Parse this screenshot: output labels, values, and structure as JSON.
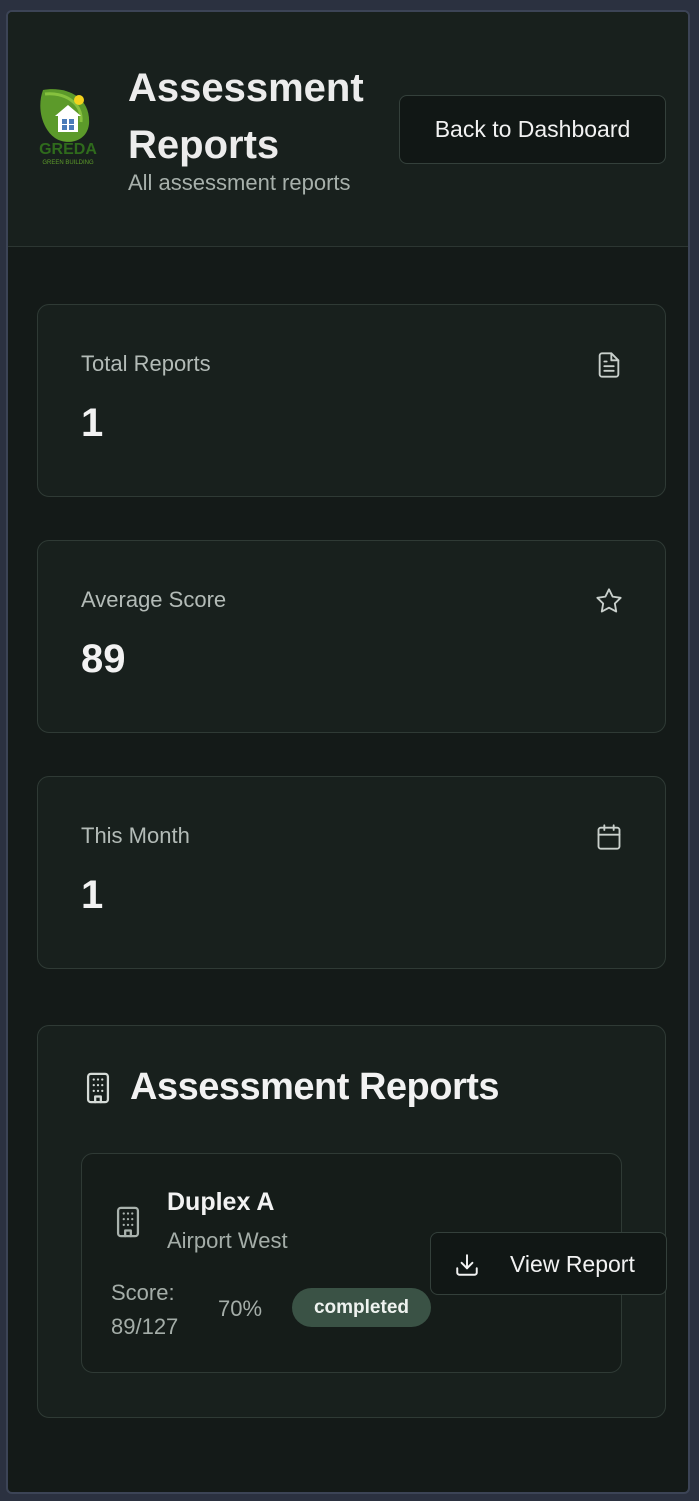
{
  "header": {
    "logo_text": "GREDA",
    "logo_subtext": "GREEN BUILDING",
    "title": "Assessment Reports",
    "subtitle": "All assessment reports",
    "back_label": "Back to Dashboard"
  },
  "stats": [
    {
      "label": "Total Reports",
      "value": "1",
      "icon": "file-text-icon"
    },
    {
      "label": "Average Score",
      "value": "89",
      "icon": "star-icon"
    },
    {
      "label": "This Month",
      "value": "1",
      "icon": "calendar-icon"
    }
  ],
  "reports": {
    "title": "Assessment Reports",
    "icon": "building-icon",
    "items": [
      {
        "name": "Duplex A",
        "location": "Airport West",
        "score": "Score: 89/127",
        "percent": "70%",
        "status": "completed",
        "action_label": "View Report"
      }
    ]
  },
  "colors": {
    "background": "#141a18",
    "card": "#18201d",
    "badge": "#3a5245",
    "text": "#f2f2f2"
  }
}
